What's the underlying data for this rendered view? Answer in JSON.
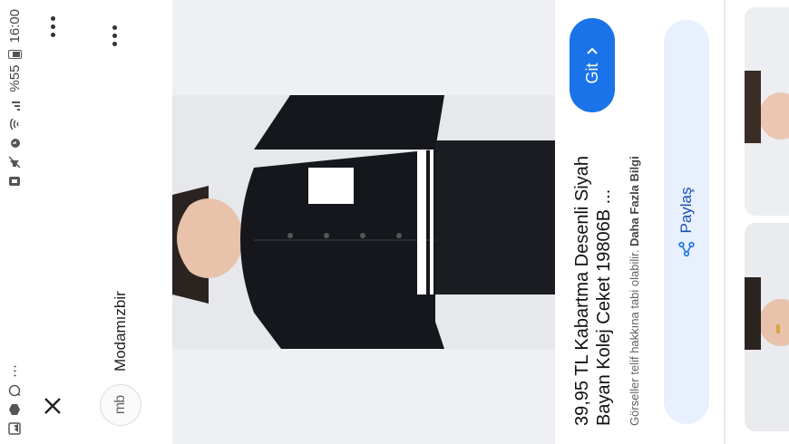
{
  "status_bar": {
    "time": "16:00",
    "battery": "%55"
  },
  "header": {
    "source_name": "Modamızbir",
    "avatar_text": "mb"
  },
  "product": {
    "title": "39,95 TL Kabartma Desenli Siyah Bayan Kolej Ceket 19806B ...",
    "notice": "Görseller telif hakkına tabi olabilir.",
    "more_info": "Daha Fazla Bilgi",
    "go_label": "Git",
    "share_label": "Paylaş"
  },
  "colors": {
    "accent": "#1a73e8",
    "share_bg": "#e8f0fe"
  },
  "icons": [
    "close-icon",
    "more-icon",
    "share-icon",
    "chevron-right-icon",
    "wifi-icon",
    "signal-icon",
    "alarm-icon",
    "whatsapp-icon",
    "gallery-icon"
  ]
}
